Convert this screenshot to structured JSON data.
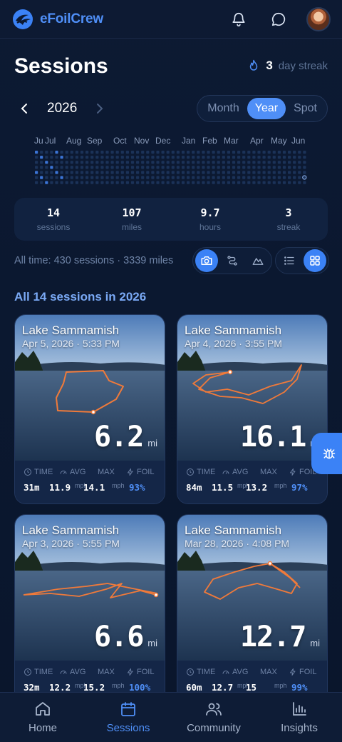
{
  "app": {
    "name": "eFoilCrew"
  },
  "header": {
    "title": "Sessions",
    "streak_value": "3",
    "streak_label": "day streak"
  },
  "year_nav": {
    "year": "2026"
  },
  "view_modes": [
    {
      "label": "Month",
      "active": false
    },
    {
      "label": "Year",
      "active": true
    },
    {
      "label": "Spot",
      "active": false
    }
  ],
  "heatmap": {
    "months": [
      "Ju",
      "Jul",
      "Aug",
      "Sep",
      "Oct",
      "Nov",
      "Dec",
      "Jan",
      "Feb",
      "Mar",
      "Apr",
      "May",
      "Jun"
    ]
  },
  "stats": [
    {
      "value": "14",
      "label": "sessions"
    },
    {
      "value": "107",
      "label": "miles"
    },
    {
      "value": "9.7",
      "label": "hours"
    },
    {
      "value": "3",
      "label": "streak"
    }
  ],
  "alltime_text": "All time: 430 sessions · 3339 miles",
  "section_title": "All 14 sessions in 2026",
  "card_labels": {
    "time": "TIME",
    "avg": "AVG",
    "max": "MAX",
    "foil": "FOIL",
    "unit_dist": "mi",
    "unit_speed": "mph"
  },
  "sessions": [
    {
      "spot": "Lake Sammamish",
      "date": "Apr 5, 2026 · 5:33 PM",
      "distance": "6.2",
      "time": "31m",
      "avg": "11.9",
      "max": "14.1",
      "foil": "93%"
    },
    {
      "spot": "Lake Sammamish",
      "date": "Apr 4, 2026 · 3:55 PM",
      "distance": "16.1",
      "time": "84m",
      "avg": "11.5",
      "max": "13.2",
      "foil": "97%"
    },
    {
      "spot": "Lake Sammamish",
      "date": "Apr 3, 2026 · 5:55 PM",
      "distance": "6.6",
      "time": "32m",
      "avg": "12.2",
      "max": "15.2",
      "foil": "100%"
    },
    {
      "spot": "Lake Sammamish",
      "date": "Mar 28, 2026 · 4:08 PM",
      "distance": "12.7",
      "time": "60m",
      "avg": "12.7",
      "max": "15",
      "foil": "99%"
    }
  ],
  "bottom_nav": [
    {
      "label": "Home",
      "active": false
    },
    {
      "label": "Sessions",
      "active": true
    },
    {
      "label": "Community",
      "active": false
    },
    {
      "label": "Insights",
      "active": false
    }
  ],
  "colors": {
    "accent": "#4f8ff7",
    "background": "#0b1830",
    "card": "#112240",
    "route": "#f07a3a"
  }
}
